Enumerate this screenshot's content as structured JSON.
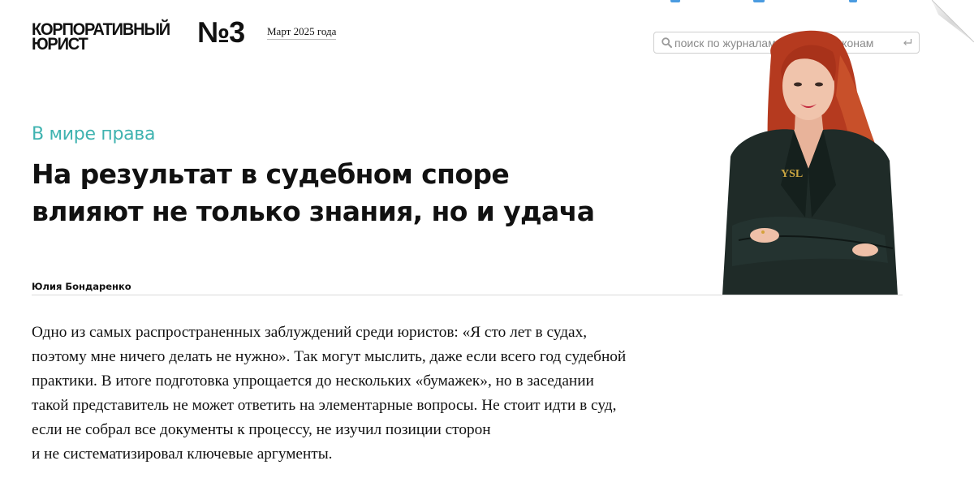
{
  "header": {
    "logo_line1": "КОРПОРАТИВНЫЙ",
    "logo_line2": "ЮРИСТ",
    "issue_number": "№3",
    "issue_date": "Март 2025 года"
  },
  "search": {
    "placeholder": "поиск по журналам, книгам и законам",
    "value": ""
  },
  "article": {
    "rubric": "В мире права",
    "title_lines": [
      "На результат в судебном споре",
      "влияют не только знания, но и удача"
    ],
    "author": "Юлия Бондаренко",
    "lead_lines": [
      "Одно из самых распространенных заблуждений среди юристов: «Я сто лет в судах,",
      "поэтому мне ничего делать не нужно». Так могут мыслить, даже если всего год судебной",
      "практики. В итоге подготовка упрощается до нескольких «бумажек», но в заседании",
      "такой представитель не может ответить на элементарные вопросы. Не стоит идти в суд,",
      "если не собрал все документы к процессу, не изучил позиции сторон",
      "и не систематизировал ключевые аргументы."
    ]
  },
  "colors": {
    "accent_teal": "#3fb3b0",
    "text": "#111111",
    "divider": "#d9d9d9",
    "top_icon_blue": "#4a9be0"
  },
  "icons": {
    "search": "search-icon",
    "enter": "enter-return-icon",
    "page_corner": "page-corner-fold-icon",
    "portrait": "author-portrait-photo"
  }
}
